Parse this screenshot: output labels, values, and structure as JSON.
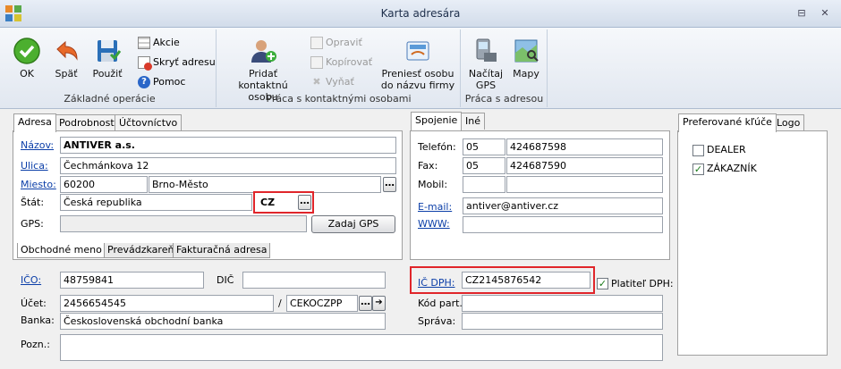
{
  "window": {
    "title": "Karta adresára",
    "btn_restore": "⊟",
    "btn_close": "✕"
  },
  "ribbon": {
    "groups": [
      {
        "label": "Základné operácie"
      },
      {
        "label": "Práca s kontaktnými osobami"
      },
      {
        "label": "Práca s adresou"
      }
    ],
    "ok": "OK",
    "back": "Späť",
    "use": "Použiť",
    "actions": "Akcie",
    "hide_address": "Skryť adresu",
    "help": "Pomoc",
    "add_contact_1": "Pridať kontaktnú",
    "add_contact_2": "osobu",
    "edit": "Opraviť",
    "copy": "Kopírovať",
    "remove": "Vyňať",
    "transfer_1": "Preniesť osobu",
    "transfer_2": "do názvu firmy",
    "load_gps_1": "Načítaj",
    "load_gps_2": "GPS",
    "maps": "Mapy"
  },
  "address_tabs": [
    "Adresa",
    "Podrobnosti",
    "Účtovníctvo"
  ],
  "address": {
    "name_label": "Názov:",
    "name": "ANTIVER a.s.",
    "street_label": "Ulica:",
    "street": "Čechmánkova 12",
    "place_label": "Miesto:",
    "zip": "60200",
    "city": "Brno-Město",
    "state_label": "Štát:",
    "state": "Česká republika",
    "state_code": "CZ",
    "gps_label": "GPS:",
    "gps": "",
    "gps_button": "Zadaj GPS",
    "bottom_tabs": [
      "Obchodné meno",
      "Prevádzkareň",
      "Fakturačná adresa"
    ]
  },
  "contact_tabs": [
    "Spojenie",
    "Iné"
  ],
  "contact": {
    "phone_label": "Telefón:",
    "phone_prefix": "05",
    "phone": "424687598",
    "fax_label": "Fax:",
    "fax_prefix": "05",
    "fax": "424687590",
    "mobile_label": "Mobil:",
    "mobile_prefix": "",
    "mobile": "",
    "email_label": "E-mail:",
    "email": "antiver@antiver.cz",
    "www_label": "WWW:",
    "www": ""
  },
  "pref_tabs": [
    "Preferované kľúče",
    "Logo"
  ],
  "pref_keys": [
    {
      "label": "DEALER",
      "checked": false
    },
    {
      "label": "ZÁKAZNÍK",
      "checked": true
    }
  ],
  "finance": {
    "ico_label": "IČO:",
    "ico": "48759841",
    "dic_label": "DIČ",
    "dic": "",
    "account_label": "Účet:",
    "account": "2456654545",
    "slash": "/",
    "bank_code": "CEKOCZPP",
    "bank_label": "Banka:",
    "bank": "Československá obchodní banka",
    "note_label": "Pozn.:",
    "note": ""
  },
  "vat": {
    "ic_dph_label": "IČ DPH:",
    "ic_dph": "CZ2145876542",
    "vat_payer_label": "Platiteľ DPH:",
    "vat_payer": true,
    "part_code_label": "Kód part.:",
    "part_code": "",
    "admin_label": "Správa:",
    "admin": ""
  }
}
